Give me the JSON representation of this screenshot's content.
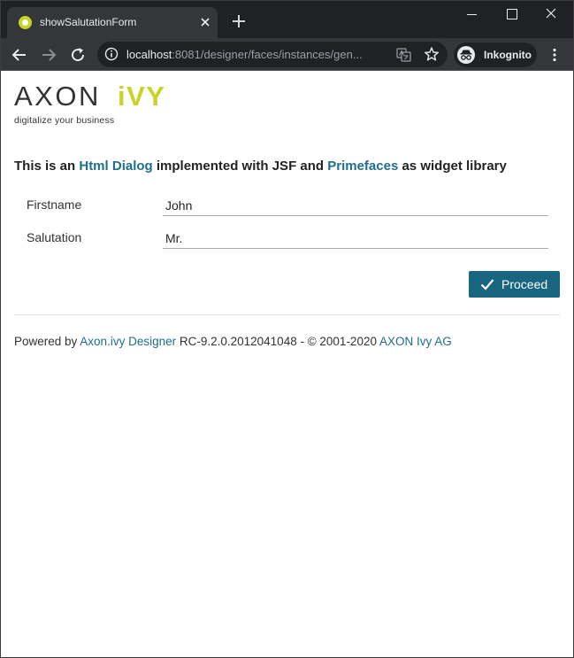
{
  "browser": {
    "tab_title": "showSalutationForm",
    "url_host": "localhost",
    "url_rest": ":8081/designer/faces/instances/gen...",
    "profile_label": "Inkognito",
    "favicon_color": "#c7d426",
    "chrome_bg": "#202124",
    "toolbar_bg": "#35363a"
  },
  "logo": {
    "brand_left": "AXON",
    "brand_right": "iVY",
    "tagline": "digitalize your business",
    "accent_color": "#c7d426"
  },
  "intro": {
    "text_1": "This is an ",
    "link_1": "Html Dialog",
    "text_2": " implemented with JSF and ",
    "link_2": "Primefaces",
    "text_3": " as widget library"
  },
  "form": {
    "fields": [
      {
        "label": "Firstname",
        "value": "John"
      },
      {
        "label": "Salutation",
        "value": "Mr."
      }
    ],
    "proceed_label": "Proceed",
    "button_color": "#17657f"
  },
  "footer": {
    "text_1": "Powered by ",
    "link_1": "Axon.ivy Designer",
    "text_2": " RC-9.2.0.2012041048 - © 2001-2020 ",
    "link_2": "AXON Ivy AG",
    "link_color": "#1f6e8c"
  }
}
